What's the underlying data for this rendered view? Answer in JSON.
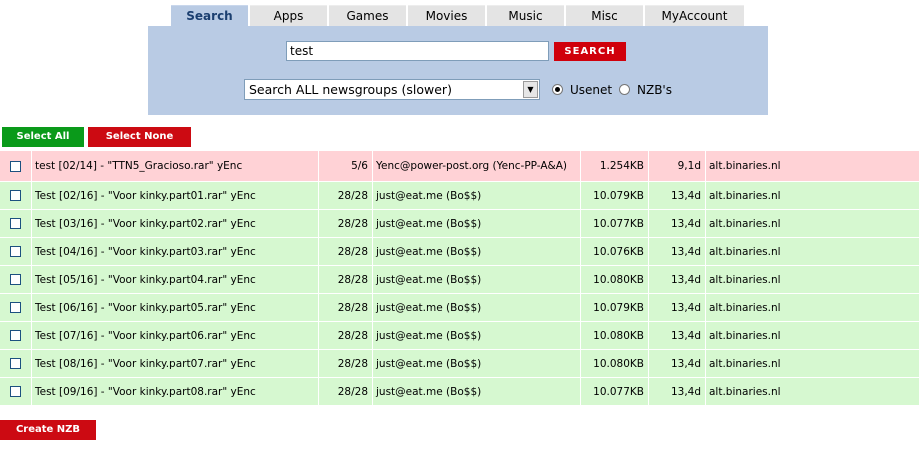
{
  "tabs": [
    {
      "label": "Search",
      "active": true
    },
    {
      "label": "Apps",
      "active": false
    },
    {
      "label": "Games",
      "active": false
    },
    {
      "label": "Movies",
      "active": false
    },
    {
      "label": "Music",
      "active": false
    },
    {
      "label": "Misc",
      "active": false
    },
    {
      "label": "MyAccount",
      "active": false
    }
  ],
  "search": {
    "query": "test",
    "button_label": "SEARCH",
    "scope_selected": "Search ALL newsgroups (slower)",
    "source_options": [
      {
        "label": "Usenet",
        "checked": true
      },
      {
        "label": "NZB's",
        "checked": false
      }
    ]
  },
  "actions": {
    "select_all": "Select All",
    "select_none": "Select None",
    "create_nzb": "Create NZB"
  },
  "results": [
    {
      "subject": "test [02/14] - \"TTN5_Gracioso.rar\" yEnc",
      "parts": "5/6",
      "poster": "Yenc@power-post.org (Yenc-PP-A&A)",
      "size": "1.254KB",
      "age": "9,1d",
      "group": "alt.binaries.nl",
      "status": "incomplete"
    },
    {
      "subject": "Test [02/16] - \"Voor kinky.part01.rar\" yEnc",
      "parts": "28/28",
      "poster": "just@eat.me (Bo$$)",
      "size": "10.079KB",
      "age": "13,4d",
      "group": "alt.binaries.nl",
      "status": "complete"
    },
    {
      "subject": "Test [03/16] - \"Voor kinky.part02.rar\" yEnc",
      "parts": "28/28",
      "poster": "just@eat.me (Bo$$)",
      "size": "10.077KB",
      "age": "13,4d",
      "group": "alt.binaries.nl",
      "status": "complete"
    },
    {
      "subject": "Test [04/16] - \"Voor kinky.part03.rar\" yEnc",
      "parts": "28/28",
      "poster": "just@eat.me (Bo$$)",
      "size": "10.076KB",
      "age": "13,4d",
      "group": "alt.binaries.nl",
      "status": "complete"
    },
    {
      "subject": "Test [05/16] - \"Voor kinky.part04.rar\" yEnc",
      "parts": "28/28",
      "poster": "just@eat.me (Bo$$)",
      "size": "10.080KB",
      "age": "13,4d",
      "group": "alt.binaries.nl",
      "status": "complete"
    },
    {
      "subject": "Test [06/16] - \"Voor kinky.part05.rar\" yEnc",
      "parts": "28/28",
      "poster": "just@eat.me (Bo$$)",
      "size": "10.079KB",
      "age": "13,4d",
      "group": "alt.binaries.nl",
      "status": "complete"
    },
    {
      "subject": "Test [07/16] - \"Voor kinky.part06.rar\" yEnc",
      "parts": "28/28",
      "poster": "just@eat.me (Bo$$)",
      "size": "10.080KB",
      "age": "13,4d",
      "group": "alt.binaries.nl",
      "status": "complete"
    },
    {
      "subject": "Test [08/16] - \"Voor kinky.part07.rar\" yEnc",
      "parts": "28/28",
      "poster": "just@eat.me (Bo$$)",
      "size": "10.080KB",
      "age": "13,4d",
      "group": "alt.binaries.nl",
      "status": "complete"
    },
    {
      "subject": "Test [09/16] - \"Voor kinky.part08.rar\" yEnc",
      "parts": "28/28",
      "poster": "just@eat.me (Bo$$)",
      "size": "10.077KB",
      "age": "13,4d",
      "group": "alt.binaries.nl",
      "status": "complete"
    }
  ],
  "colors": {
    "tab_active_bg": "#b9cbe4",
    "tab_bg": "#e4e4e4",
    "panel_bg": "#b9cbe4",
    "search_button_bg": "#d0000b",
    "select_all_bg": "#0a9a1a",
    "red_button_bg": "#cc0a12",
    "row_incomplete_bg": "#ffd2d6",
    "row_complete_bg": "#d6f8d0"
  }
}
